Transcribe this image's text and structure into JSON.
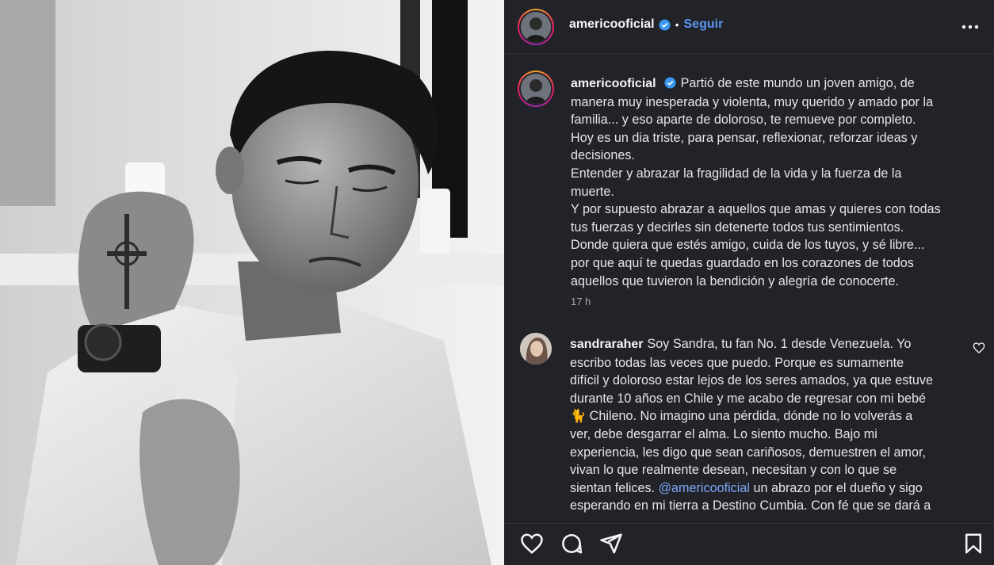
{
  "post": {
    "username": "americooficial",
    "follow_label": "Seguir",
    "separator": "•",
    "caption_lines": [
      "Partió de este mundo un joven amigo, de",
      "manera muy inesperada y violenta, muy querido y amado por la",
      "familia... y eso aparte de doloroso, te remueve por completo.",
      "Hoy es un dia triste, para pensar, reflexionar, reforzar ideas y",
      "decisiones.",
      "Entender y abrazar la fragilidad de la vida y la fuerza de la",
      "muerte.",
      "Y por supuesto abrazar a aquellos que amas y quieres con todas",
      "tus fuerzas y decirles sin detenerte todos tus sentimientos.",
      "Donde quiera que estés amigo, cuida de los tuyos, y sé libre...",
      "por que aquí te quedas guardado en los corazones de todos",
      "aquellos que tuvieron la bendición y alegría de conocerte."
    ],
    "time_ago": "17 h"
  },
  "comment": {
    "username": "sandraraher",
    "lines": [
      "Soy Sandra, tu fan No. 1 desde Venezuela. Yo",
      "escribo todas las veces que puedo. Porque es sumamente",
      "difícil y doloroso estar lejos de los seres amados, ya que estuve",
      "durante 10 años en Chile y me acabo de regresar con mi bebé",
      "🐈 Chileno. No imagino una pérdida, dónde no lo volverás a",
      "ver, debe desgarrar el alma. Lo siento mucho. Bajo mi",
      "experiencia, les digo que sean cariñosos, demuestren el amor,",
      "vivan lo que realmente desean, necesitan y con lo que se",
      "sientan felices."
    ],
    "mention": "@americooficial",
    "after_mention": " un abrazo por el dueño y sigo",
    "lines_after": [
      "esperando en mi tierra a Destino Cumbia. Con fé que se dará a"
    ]
  },
  "icons": {
    "verified": "verified-badge-icon",
    "more": "more-options-icon",
    "like": "heart-icon",
    "comment": "comment-icon",
    "share": "share-icon",
    "save": "bookmark-icon"
  },
  "colors": {
    "panel_bg": "#212328",
    "follow_blue": "#5b95f2",
    "mention_blue": "#7da6f5",
    "verified_blue": "#3897f0"
  }
}
